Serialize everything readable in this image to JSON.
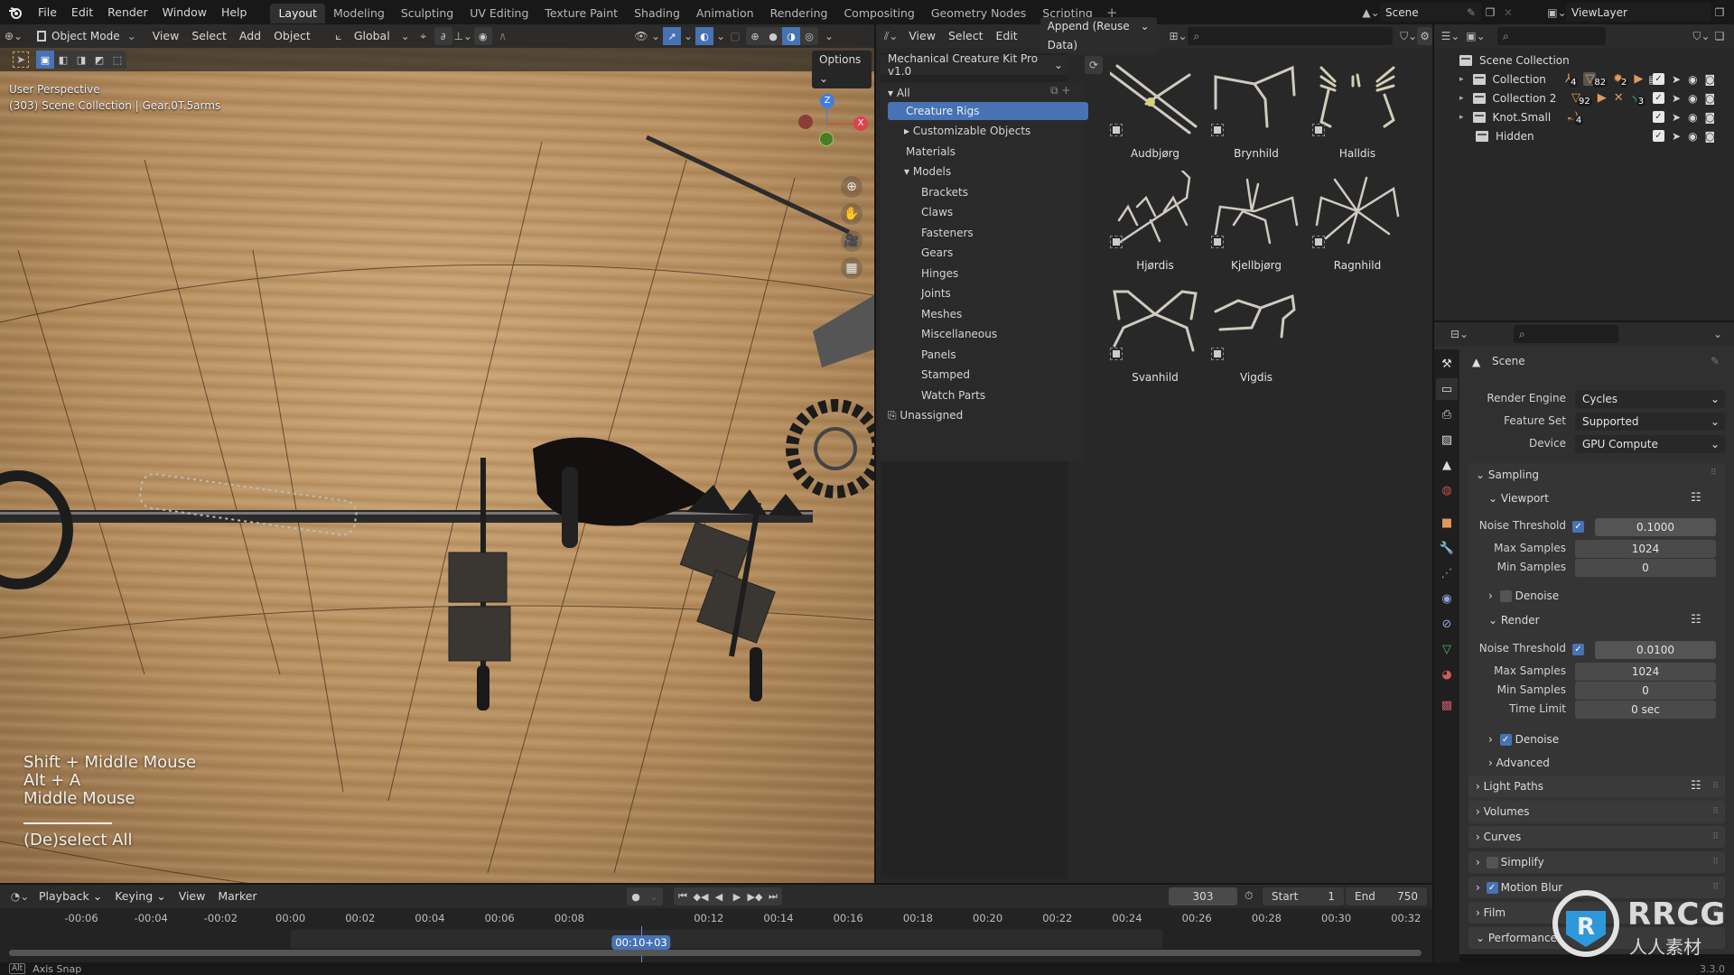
{
  "app": {
    "menu": [
      "File",
      "Edit",
      "Render",
      "Window",
      "Help"
    ],
    "workspaces": [
      "Layout",
      "Modeling",
      "Sculpting",
      "UV Editing",
      "Texture Paint",
      "Shading",
      "Animation",
      "Rendering",
      "Compositing",
      "Geometry Nodes",
      "Scripting"
    ],
    "active_workspace": "Layout",
    "add_workspace": "+",
    "scene": "Scene",
    "view_layer": "ViewLayer",
    "version": "3.3.0"
  },
  "viewport": {
    "mode": "Object Mode",
    "menus": [
      "View",
      "Select",
      "Add",
      "Object"
    ],
    "transform_orientation": "Global",
    "options_label": "Options",
    "perspective": "User Perspective",
    "context": "(303) Scene Collection | Gear.0T.5arms",
    "gizmo_axes": {
      "z": "Z",
      "y": "Y",
      "x": "X"
    },
    "key_overlay": [
      "Shift + Middle Mouse",
      "Alt + A",
      "Middle Mouse"
    ],
    "key_overlay_action": "(De)select All"
  },
  "asset_browser": {
    "menus": [
      "View",
      "Select",
      "Edit"
    ],
    "import_method": "Append (Reuse Data)",
    "library": "Mechanical Creature Kit Pro v1.0",
    "categories": [
      {
        "label": "All",
        "level": 0,
        "expanded": true
      },
      {
        "label": "Creature Rigs",
        "level": 1,
        "selected": true
      },
      {
        "label": "Customizable Objects",
        "level": 1,
        "collapsed": true
      },
      {
        "label": "Materials",
        "level": 1
      },
      {
        "label": "Models",
        "level": 1,
        "expanded": true
      },
      {
        "label": "Brackets",
        "level": 2
      },
      {
        "label": "Claws",
        "level": 2
      },
      {
        "label": "Fasteners",
        "level": 2
      },
      {
        "label": "Gears",
        "level": 2
      },
      {
        "label": "Hinges",
        "level": 2
      },
      {
        "label": "Joints",
        "level": 2
      },
      {
        "label": "Meshes",
        "level": 2
      },
      {
        "label": "Miscellaneous",
        "level": 2
      },
      {
        "label": "Panels",
        "level": 2
      },
      {
        "label": "Stamped",
        "level": 2
      },
      {
        "label": "Watch Parts",
        "level": 2
      },
      {
        "label": "Unassigned",
        "level": 0
      }
    ],
    "assets": [
      "Audbjørg",
      "Brynhild",
      "Halldis",
      "Hjørdis",
      "Kjellbjørg",
      "Ragnhild",
      "Svanhild",
      "Vigdis"
    ]
  },
  "outliner": {
    "root": "Scene Collection",
    "rows": [
      {
        "label": "Collection",
        "badges": [
          "4",
          "82",
          "2"
        ]
      },
      {
        "label": "Collection 2",
        "badges": [
          "92",
          "3"
        ]
      },
      {
        "label": "Knot.Small",
        "badges": [
          "4"
        ]
      },
      {
        "label": "Hidden",
        "badges": []
      }
    ]
  },
  "properties": {
    "context": "Scene",
    "render_engine_label": "Render Engine",
    "render_engine": "Cycles",
    "feature_set_label": "Feature Set",
    "feature_set": "Supported",
    "device_label": "Device",
    "device": "GPU Compute",
    "sampling": "Sampling",
    "viewport": {
      "title": "Viewport",
      "noise_threshold_label": "Noise Threshold",
      "noise_threshold": "0.1000",
      "noise_enabled": true,
      "max_samples_label": "Max Samples",
      "max_samples": "1024",
      "min_samples_label": "Min Samples",
      "min_samples": "0",
      "denoise_label": "Denoise",
      "denoise": false
    },
    "render": {
      "title": "Render",
      "noise_threshold_label": "Noise Threshold",
      "noise_threshold": "0.0100",
      "noise_enabled": true,
      "max_samples_label": "Max Samples",
      "max_samples": "1024",
      "min_samples_label": "Min Samples",
      "min_samples": "0",
      "time_limit_label": "Time Limit",
      "time_limit": "0 sec",
      "denoise_label": "Denoise",
      "denoise": true
    },
    "advanced": "Advanced",
    "panels": [
      {
        "label": "Light Paths"
      },
      {
        "label": "Volumes"
      },
      {
        "label": "Curves"
      },
      {
        "label": "Simplify",
        "checkbox": false
      },
      {
        "label": "Motion Blur",
        "checkbox": true
      },
      {
        "label": "Film"
      },
      {
        "label": "Performance",
        "expanded": true
      }
    ]
  },
  "timeline": {
    "menus": [
      "Playback",
      "Keying",
      "View",
      "Marker"
    ],
    "current_frame": "303",
    "current_time": "00:10+03",
    "start_label": "Start",
    "start": "1",
    "end_label": "End",
    "end": "750",
    "ticks": [
      "-00:06",
      "-00:04",
      "-00:02",
      "00:00",
      "00:02",
      "00:04",
      "00:06",
      "00:08",
      "00:12",
      "00:14",
      "00:16",
      "00:18",
      "00:20",
      "00:22",
      "00:24",
      "00:26",
      "00:28",
      "00:30",
      "00:32"
    ]
  },
  "status": {
    "key": "Alt",
    "hint": "Axis Snap"
  },
  "watermark": {
    "text": "RRCG",
    "sub": "人人素材"
  },
  "colors": {
    "accent": "#4772b3",
    "panel": "#303030",
    "header": "#181818"
  }
}
